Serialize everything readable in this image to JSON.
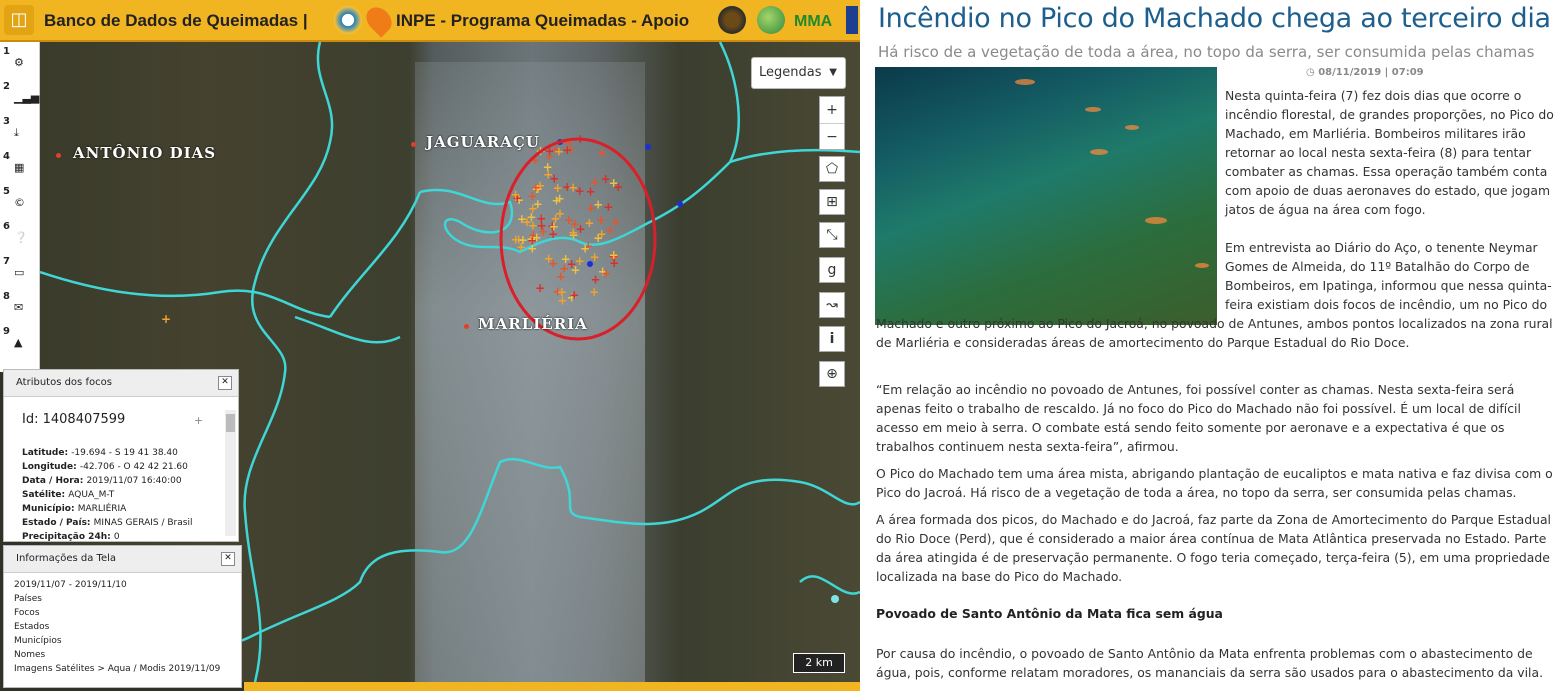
{
  "map_app": {
    "header": {
      "title": "Banco de Dados de Queimadas |",
      "subtitle": "INPE - Programa Queimadas - Apoio",
      "mma": "MMA"
    },
    "sidebar": {
      "items": [
        {
          "num": "1",
          "icon": "gears-icon"
        },
        {
          "num": "2",
          "icon": "bar-chart-icon"
        },
        {
          "num": "3",
          "icon": "download-icon"
        },
        {
          "num": "4",
          "icon": "table-icon"
        },
        {
          "num": "5",
          "icon": "copyright-icon"
        },
        {
          "num": "6",
          "icon": "help-icon"
        },
        {
          "num": "7",
          "icon": "monitor-icon"
        },
        {
          "num": "8",
          "icon": "envelope-icon"
        },
        {
          "num": "9",
          "icon": "warning-icon"
        }
      ]
    },
    "legend_button": "Legendas",
    "places": [
      "ANTÔNIO DIAS",
      "JAGUARAÇU",
      "MARLIÉRIA"
    ],
    "tools": {
      "zoom_in": "+",
      "zoom_out": "−",
      "info": "i",
      "google": "g"
    },
    "scale": "2 km",
    "attributes_panel": {
      "title": "Atributos dos focos",
      "id_label": "Id:",
      "id_value": "1408407599",
      "rows": [
        {
          "label": "Latitude:",
          "value": "-19.694 - S 19 41 38.40"
        },
        {
          "label": "Longitude:",
          "value": "-42.706 - O 42 42 21.60"
        },
        {
          "label": "Data / Hora:",
          "value": "2019/11/07 16:40:00"
        },
        {
          "label": "Satélite:",
          "value": "AQUA_M-T"
        },
        {
          "label": "Município:",
          "value": "MARLIÉRIA"
        },
        {
          "label": "Estado / País:",
          "value": "MINAS GERAIS / Brasil"
        },
        {
          "label": "Precipitação 24h:",
          "value": "0"
        }
      ]
    },
    "info_panel": {
      "title": "Informações da Tela",
      "lines": [
        "2019/11/07 - 2019/11/10",
        "Países",
        "Focos",
        "Estados",
        "Municípios",
        "Nomes",
        "Imagens Satélites > Aqua / Modis 2019/11/09"
      ]
    },
    "colors": {
      "header": "#f2b522",
      "river": "#3fd6d6",
      "highlight_ellipse": "#d9202a"
    }
  },
  "article": {
    "title": "Incêndio no Pico do Machado chega ao terceiro dia",
    "subtitle": "Há risco de a vegetação de toda a área, no topo da serra, ser consumida pelas chamas",
    "date": "08/11/2019 | 07:09",
    "paragraphs": [
      "Nesta quinta-feira (7) fez dois dias que ocorre o incêndio florestal, de grandes proporções, no Pico do Machado, em Marliéria. Bombeiros militares irão retornar ao local nesta sexta-feira (8) para tentar combater as chamas. Essa operação também conta com apoio de duas aeronaves do estado, que jogam jatos de água na área com fogo.",
      "Em entrevista ao Diário do Aço, o tenente Neymar Gomes de Almeida, do 11º Batalhão do Corpo de Bombeiros, em Ipatinga, informou que nessa quinta-feira existiam dois focos de incêndio, um no Pico do Machado e outro próximo ao Pico do Jacroá, no povoado de Antunes, ambos pontos localizados na zona rural de Marliéria e consideradas áreas de amortecimento do Parque Estadual do Rio Doce.",
      "“Em relação ao incêndio no povoado de Antunes, foi possível conter as chamas. Nesta sexta-feira será apenas feito o trabalho de rescaldo. Já no foco do Pico do Machado não foi possível. É um local de difícil acesso em meio à serra. O combate está sendo feito somente por aeronave e a expectativa é que os trabalhos continuem nesta sexta-feira”, afirmou.",
      "O Pico do Machado tem uma área mista, abrigando plantação de eucaliptos e mata nativa e faz divisa com o Pico do Jacroá. Há risco de a vegetação de toda a área, no topo da serra, ser consumida pelas chamas.",
      "A área formada dos picos, do Machado e do Jacroá, faz parte da Zona de Amortecimento do Parque Estadual do Rio Doce (Perd), que é considerado a maior área contínua de Mata Atlântica preservada no Estado. Parte da área atingida é de preservação permanente. O fogo teria começado, terça-feira (5), em uma propriedade localizada na base do Pico do Machado."
    ],
    "section_title": "Povoado de Santo Antônio da Mata fica sem água",
    "section_paragraph": "Por causa do incêndio, o povoado de Santo Antônio da Mata enfrenta problemas com o abastecimento de água, pois, conforme relatam moradores, os mananciais da serra são usados para o abastecimento da vila."
  }
}
